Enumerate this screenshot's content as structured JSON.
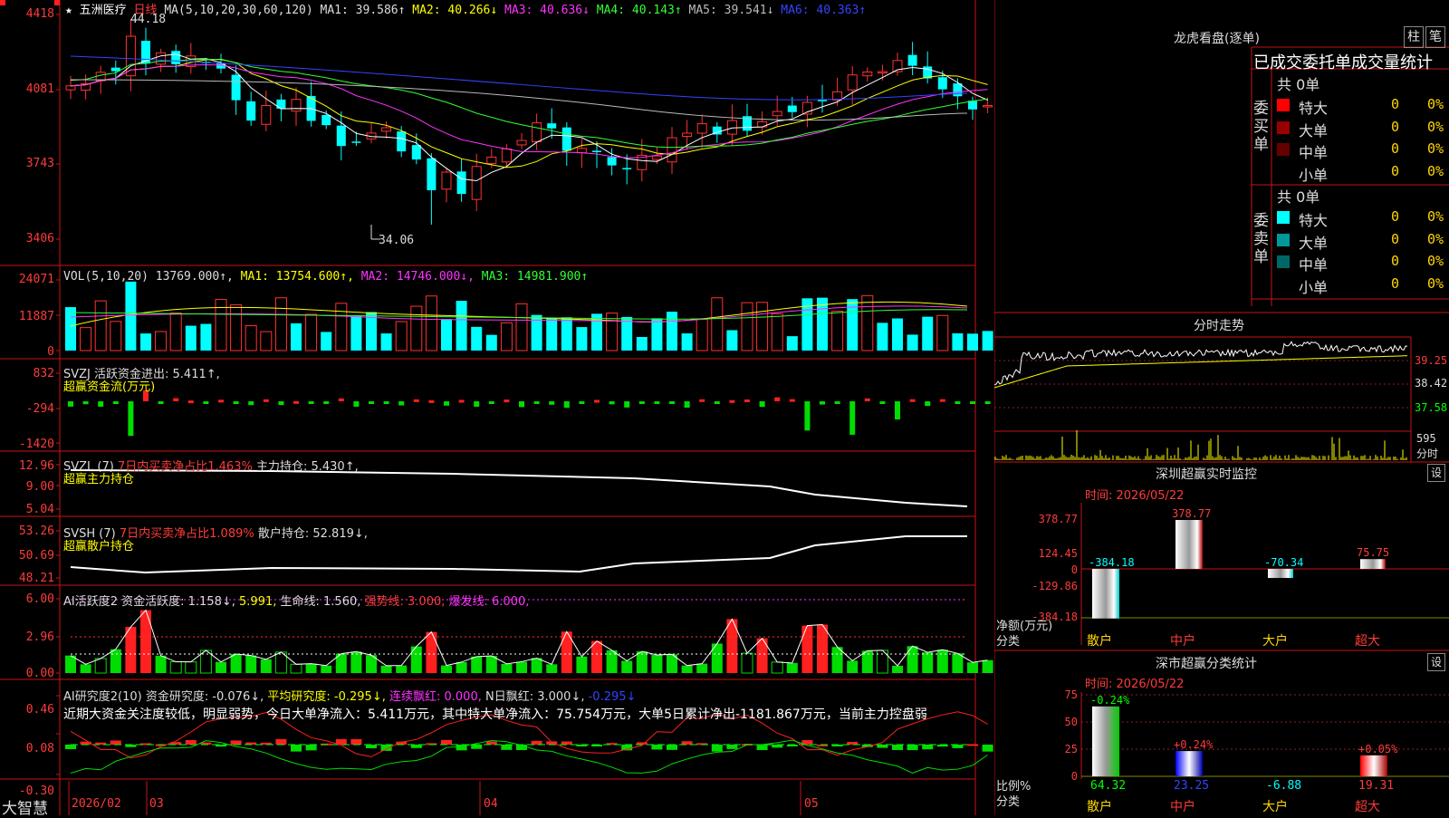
{
  "main": {
    "title": "五洲医疗",
    "period": "日线",
    "ma_legend": [
      {
        "label": "MA(5,10,20,30,60,120)",
        "color": "#dddddd"
      },
      {
        "label": "MA1: 39.586↑",
        "color": "#dddddd"
      },
      {
        "label": "MA2: 40.266↓",
        "color": "#ffff00"
      },
      {
        "label": "MA3: 40.636↓",
        "color": "#ff33ff"
      },
      {
        "label": "MA4: 40.143↑",
        "color": "#33ff33"
      },
      {
        "label": "MA5: 39.541↓",
        "color": "#bbbbbb"
      },
      {
        "label": "MA6: 40.363↑",
        "color": "#3344ff"
      }
    ],
    "y_labels": [
      "4418",
      "4081",
      "3743",
      "3406"
    ],
    "high_label": "44.18",
    "low_label": "34.06",
    "star": "★"
  },
  "vol": {
    "legend": [
      {
        "label": "VOL(5,10,20)",
        "color": "#dddddd"
      },
      {
        "label": "13769.000↑,",
        "color": "#dddddd"
      },
      {
        "label": "MA1: 13754.600↑,",
        "color": "#ffff00"
      },
      {
        "label": "MA2: 14746.000↓,",
        "color": "#ff33ff"
      },
      {
        "label": "MA3: 14981.900↑",
        "color": "#33ff33"
      }
    ],
    "y_labels": [
      "24071",
      "11887",
      "0"
    ]
  },
  "svzj": {
    "legend1": "SVZJ  活跃资金进出: 5.411↑,",
    "legend2": "超赢资金流(万元)",
    "y_labels": [
      "832",
      "-294",
      "-1420"
    ]
  },
  "svzl": {
    "legend_a": "SVZL (7)",
    "legend_b": "7日内买卖净占比1.463%",
    "legend_c": "主力持仓: 5.430↑,",
    "legend2": "超赢主力持仓",
    "y_labels": [
      "12.96",
      "9.00",
      "5.04"
    ]
  },
  "svsh": {
    "legend_a": "SVSH (7)",
    "legend_b": "7日内买卖净占比1.089%",
    "legend_c": "散户持仓: 52.819↓,",
    "legend2": "超赢散户持仓",
    "y_labels": [
      "53.26",
      "50.69",
      "48.21"
    ]
  },
  "ai1": {
    "legend": [
      {
        "label": "AI活跃度2",
        "color": "#dddddd"
      },
      {
        "label": "资金活跃度: 1.158↓,",
        "color": "#dddddd"
      },
      {
        "label": "5.991,",
        "color": "#ffff00"
      },
      {
        "label": "生命线: 1.560,",
        "color": "#dddddd"
      },
      {
        "label": "强势线: 3.000,",
        "color": "#ff3b3b"
      },
      {
        "label": "爆发线: 6.000,",
        "color": "#ff33ff"
      }
    ],
    "y_labels": [
      "6.00",
      "2.96",
      "0.00"
    ]
  },
  "ai2": {
    "legend": [
      {
        "label": "AI研究度2(10)",
        "color": "#dddddd"
      },
      {
        "label": "资金研究度: -0.076↓,",
        "color": "#dddddd"
      },
      {
        "label": "平均研究度: -0.295↓,",
        "color": "#ffff00"
      },
      {
        "label": "连续飘红: 0.000,",
        "color": "#ff33ff"
      },
      {
        "label": "N日飘红: 3.000↓,",
        "color": "#dddddd"
      },
      {
        "label": "-0.295↓",
        "color": "#3344ff"
      }
    ],
    "comment": "近期大资金关注度较低，明显弱势，今日大单净流入：5.411万元，其中特大单净流入：75.754万元，大单5日累计净出-1181.867万元，当前主力控盘弱",
    "y_labels": [
      "0.46",
      "0.08",
      "-0.30"
    ]
  },
  "bottom_axis": {
    "brand": "大智慧",
    "dates": [
      "2026/02",
      "03",
      "04",
      "05"
    ]
  },
  "right": {
    "lhb_title": "龙虎看盘(逐单)",
    "btn_zhu": "柱",
    "btn_bi": "笔",
    "stats_title": "已成交委托单成交量统计",
    "buy_side": {
      "side_label": "委买单",
      "total": "共 0单",
      "rows": [
        {
          "name": "特大",
          "color": "#ff0000",
          "v1": "0",
          "v2": "0%"
        },
        {
          "name": "大单",
          "color": "#990000",
          "v1": "0",
          "v2": "0%"
        },
        {
          "name": "中单",
          "color": "#660000",
          "v1": "0",
          "v2": "0%"
        },
        {
          "name": "小单",
          "color": "#000000",
          "v1": "0",
          "v2": "0%"
        }
      ]
    },
    "sell_side": {
      "side_label": "委卖单",
      "total": "共 0单",
      "rows": [
        {
          "name": "特大",
          "color": "#00ffff",
          "v1": "0",
          "v2": "0%"
        },
        {
          "name": "大单",
          "color": "#009999",
          "v1": "0",
          "v2": "0%"
        },
        {
          "name": "中单",
          "color": "#006666",
          "v1": "0",
          "v2": "0%"
        },
        {
          "name": "小单",
          "color": "#000000",
          "v1": "0",
          "v2": "0%"
        }
      ]
    },
    "intraday": {
      "title": "分时走势",
      "price_labels": [
        "39.25",
        "38.42",
        "37.58"
      ],
      "vol_label": "595",
      "vol_unit": "分时"
    },
    "sz_monitor": {
      "title": "深圳超赢实时监控",
      "btn": "设",
      "time": "时间: 2026/05/22",
      "y_labels": [
        "378.77",
        "124.45",
        "0",
        "-129.86",
        "-384.18"
      ],
      "ylabel1": "净额(万元)",
      "ylabel2": "分类",
      "categories": [
        "散户",
        "中户",
        "大户",
        "超大"
      ],
      "values": [
        -384.18,
        378.77,
        -70.34,
        75.75
      ],
      "value_labels": [
        "-384.18",
        "378.77",
        "-70.34",
        "75.75"
      ]
    },
    "sz_class": {
      "title": "深市超赢分类统计",
      "btn": "设",
      "time": "时间: 2026/05/22",
      "y_labels": [
        "75",
        "50",
        "25",
        "0"
      ],
      "ylabel1": "比例%",
      "ylabel2": "分类",
      "categories": [
        "散户",
        "中户",
        "大户",
        "超大"
      ],
      "values": [
        64.32,
        23.25,
        -6.88,
        19.31
      ],
      "value_labels": [
        "64.32",
        "23.25",
        "-6.88",
        "19.31"
      ],
      "change_labels": [
        "-0.24%",
        "+0.24%",
        "",
        "+0.05%"
      ]
    }
  },
  "chart_data": {
    "type": "candlestick",
    "x": [
      "2026/02",
      "03",
      "04",
      "05"
    ],
    "ylim": [
      34.06,
      44.18
    ]
  }
}
